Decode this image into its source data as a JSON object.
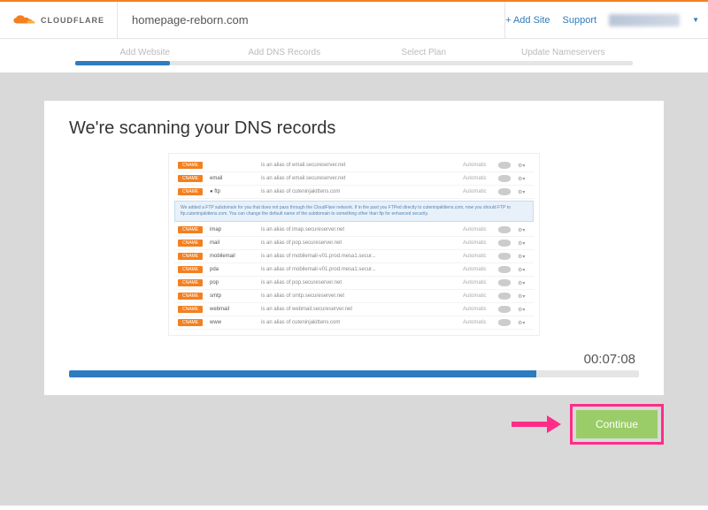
{
  "header": {
    "logo_text": "CLOUDFLARE",
    "site": "homepage-reborn.com",
    "add_site": "+ Add Site",
    "support": "Support"
  },
  "steps": {
    "items": [
      "Add Website",
      "Add DNS Records",
      "Select Plan",
      "Update Nameservers"
    ]
  },
  "main": {
    "title": "We're scanning your DNS records",
    "timer": "00:07:08",
    "continue": "Continue"
  },
  "preview": {
    "info": "We added a FTP subdomain for you that does not pass through the CloudFlare network. If in the past you FTPed directly to cuteninjakittens.com, now you should FTP to ftp.cuteninjakittens.com. You can change the default name of the subdomain to something other than ftp for enhanced security.",
    "status": "Automatic",
    "gear": "⚙",
    "rows": [
      {
        "type": "CNAME",
        "name": "",
        "val": "is an alias of email.secureserver.net"
      },
      {
        "type": "CNAME",
        "name": "email",
        "val": "is an alias of email.secureserver.net"
      },
      {
        "type": "CNAME",
        "name": "● ftp",
        "val": "is an alias of cuteninjakittens.com"
      },
      {
        "type": "CNAME",
        "name": "imap",
        "val": "is an alias of imap.secureserver.net"
      },
      {
        "type": "CNAME",
        "name": "mail",
        "val": "is an alias of pop.secureserver.net"
      },
      {
        "type": "CNAME",
        "name": "mobilemail",
        "val": "is an alias of mobilemail-v01.prod.mesa1.secur..."
      },
      {
        "type": "CNAME",
        "name": "pda",
        "val": "is an alias of mobilemail-v01.prod.mesa1.secur..."
      },
      {
        "type": "CNAME",
        "name": "pop",
        "val": "is an alias of pop.secureserver.net"
      },
      {
        "type": "CNAME",
        "name": "smtp",
        "val": "is an alias of smtp.secureserver.net"
      },
      {
        "type": "CNAME",
        "name": "webmail",
        "val": "is an alias of webmail.secureserver.net"
      },
      {
        "type": "CNAME",
        "name": "www",
        "val": "is an alias of cuteninjakittens.com"
      }
    ]
  }
}
